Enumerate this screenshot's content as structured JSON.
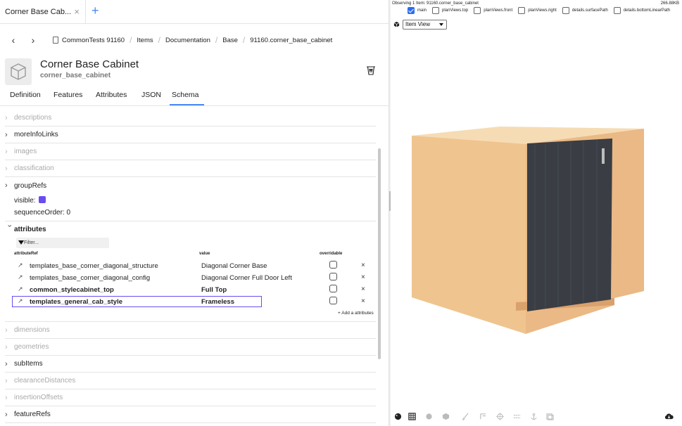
{
  "tab": {
    "title": "Corner Base Cab...",
    "close": "×",
    "new": "+"
  },
  "nav": {
    "back": "‹",
    "forward": "›"
  },
  "breadcrumb": [
    "CommonTests 91160",
    "Items",
    "Documentation",
    "Base",
    "91160.corner_base_cabinet"
  ],
  "breadcrumb_sep": "/",
  "item": {
    "title": "Corner Base Cabinet",
    "subtitle": "corner_base_cabinet"
  },
  "section_tabs": [
    "Definition",
    "Features",
    "Attributes",
    "JSON",
    "Schema"
  ],
  "active_section_tab": "Schema",
  "schema": {
    "descriptions": "descriptions",
    "moreInfoLinks": "moreInfoLinks",
    "images": "images",
    "classification": "classification",
    "groupRefs": "groupRefs",
    "visible_label": "visible:",
    "visible_value": true,
    "sequence_label": "sequenceOrder:",
    "sequence_value": "0",
    "attributes": "attributes",
    "filter_placeholder": "Filter...",
    "col_ref": "attributeRef",
    "col_value": "value",
    "col_overridable": "overridable",
    "rows": [
      {
        "ref": "templates_base_corner_diagonal_structure",
        "value": "Diagonal Corner Base",
        "bold": false,
        "overridable": false
      },
      {
        "ref": "templates_base_corner_diagonal_config",
        "value": "Diagonal Corner Full Door Left",
        "bold": false,
        "overridable": false
      },
      {
        "ref": "common_stylecabinet_top",
        "value": "Full Top",
        "bold": true,
        "overridable": false
      },
      {
        "ref": "templates_general_cab_style",
        "value": "Frameless",
        "bold": true,
        "overridable": false
      }
    ],
    "add_attribute": "+ Add a attributes",
    "dimensions": "dimensions",
    "geometries": "geometries",
    "subItems": "subItems",
    "clearanceDistances": "clearanceDistances",
    "insertionOffsets": "insertionOffsets",
    "featureRefs": "featureRefs"
  },
  "viewer": {
    "observing": "Observing 1 Item: 91160.corner_base_cabinet",
    "memory": "266.88KB",
    "toggles": [
      {
        "label": "main",
        "checked": true
      },
      {
        "label": "planViews.top",
        "checked": false
      },
      {
        "label": "planViews.front",
        "checked": false
      },
      {
        "label": "planViews.right",
        "checked": false
      },
      {
        "label": "details.surfacePath",
        "checked": false
      },
      {
        "label": "details.bottomLinearPath",
        "checked": false
      }
    ],
    "view_mode": "Item View"
  },
  "colors": {
    "accent": "#6a4cf0",
    "tab_underline": "#4a8af4",
    "cabinet_body": "#f1c892",
    "cabinet_door": "#3a3d44"
  }
}
